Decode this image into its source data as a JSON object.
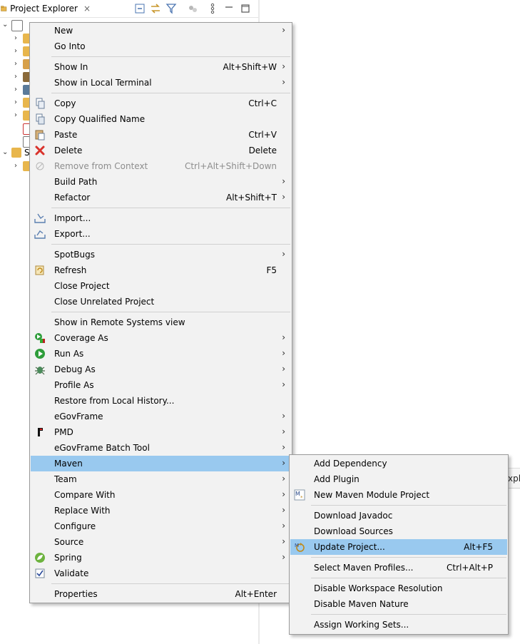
{
  "explorer": {
    "title": "Project Explorer",
    "close_glyph": "×",
    "toolbar": [
      "collapse-all-icon",
      "link-with-editor-icon",
      "filter-icon",
      "focus-icon",
      "view-menu-icon",
      "minimize-icon",
      "maximize-icon"
    ],
    "tree_partial_letter": "S"
  },
  "right_panel": {
    "partial_tab_text": "xplo"
  },
  "context_menu": {
    "items": [
      {
        "label": "New",
        "accel": "",
        "submenu": true,
        "icon": ""
      },
      {
        "label": "Go Into",
        "accel": "",
        "submenu": false,
        "icon": ""
      },
      {
        "label": "Show In",
        "accel": "Alt+Shift+W",
        "submenu": true,
        "icon": ""
      },
      {
        "label": "Show in Local Terminal",
        "accel": "",
        "submenu": true,
        "icon": ""
      },
      {
        "label": "Copy",
        "accel": "Ctrl+C",
        "submenu": false,
        "icon": "copy-icon"
      },
      {
        "label": "Copy Qualified Name",
        "accel": "",
        "submenu": false,
        "icon": "copy-qualified-name-icon"
      },
      {
        "label": "Paste",
        "accel": "Ctrl+V",
        "submenu": false,
        "icon": "paste-icon"
      },
      {
        "label": "Delete",
        "accel": "Delete",
        "submenu": false,
        "icon": "delete-icon"
      },
      {
        "label": "Remove from Context",
        "accel": "Ctrl+Alt+Shift+Down",
        "submenu": false,
        "icon": "remove-context-icon",
        "disabled": true
      },
      {
        "label": "Build Path",
        "accel": "",
        "submenu": true,
        "icon": ""
      },
      {
        "label": "Refactor",
        "accel": "Alt+Shift+T",
        "submenu": true,
        "icon": ""
      },
      {
        "label": "Import...",
        "accel": "",
        "submenu": false,
        "icon": "import-icon"
      },
      {
        "label": "Export...",
        "accel": "",
        "submenu": false,
        "icon": "export-icon"
      },
      {
        "label": "SpotBugs",
        "accel": "",
        "submenu": true,
        "icon": ""
      },
      {
        "label": "Refresh",
        "accel": "F5",
        "submenu": false,
        "icon": "refresh-icon"
      },
      {
        "label": "Close Project",
        "accel": "",
        "submenu": false,
        "icon": ""
      },
      {
        "label": "Close Unrelated Project",
        "accel": "",
        "submenu": false,
        "icon": ""
      },
      {
        "label": "Show in Remote Systems view",
        "accel": "",
        "submenu": false,
        "icon": ""
      },
      {
        "label": "Coverage As",
        "accel": "",
        "submenu": true,
        "icon": "coverage-icon"
      },
      {
        "label": "Run As",
        "accel": "",
        "submenu": true,
        "icon": "run-icon"
      },
      {
        "label": "Debug As",
        "accel": "",
        "submenu": true,
        "icon": "debug-icon"
      },
      {
        "label": "Profile As",
        "accel": "",
        "submenu": true,
        "icon": ""
      },
      {
        "label": "Restore from Local History...",
        "accel": "",
        "submenu": false,
        "icon": ""
      },
      {
        "label": "eGovFrame",
        "accel": "",
        "submenu": true,
        "icon": ""
      },
      {
        "label": "PMD",
        "accel": "",
        "submenu": true,
        "icon": "pmd-icon"
      },
      {
        "label": "eGovFrame Batch Tool",
        "accel": "",
        "submenu": true,
        "icon": ""
      },
      {
        "label": "Maven",
        "accel": "",
        "submenu": true,
        "icon": "",
        "highlighted": true
      },
      {
        "label": "Team",
        "accel": "",
        "submenu": true,
        "icon": ""
      },
      {
        "label": "Compare With",
        "accel": "",
        "submenu": true,
        "icon": ""
      },
      {
        "label": "Replace With",
        "accel": "",
        "submenu": true,
        "icon": ""
      },
      {
        "label": "Configure",
        "accel": "",
        "submenu": true,
        "icon": ""
      },
      {
        "label": "Source",
        "accel": "",
        "submenu": true,
        "icon": ""
      },
      {
        "label": "Spring",
        "accel": "",
        "submenu": true,
        "icon": "spring-icon"
      },
      {
        "label": "Validate",
        "accel": "",
        "submenu": false,
        "icon": "validate-check-icon"
      },
      {
        "label": "Properties",
        "accel": "Alt+Enter",
        "submenu": false,
        "icon": ""
      }
    ]
  },
  "maven_submenu": {
    "items": [
      {
        "label": "Add Dependency",
        "accel": "",
        "icon": ""
      },
      {
        "label": "Add Plugin",
        "accel": "",
        "icon": ""
      },
      {
        "label": "New Maven Module Project",
        "accel": "",
        "icon": "maven-module-icon"
      },
      {
        "label": "Download Javadoc",
        "accel": "",
        "icon": ""
      },
      {
        "label": "Download Sources",
        "accel": "",
        "icon": ""
      },
      {
        "label": "Update Project...",
        "accel": "Alt+F5",
        "icon": "maven-update-icon",
        "highlighted": true
      },
      {
        "label": "Select Maven Profiles...",
        "accel": "Ctrl+Alt+P",
        "icon": ""
      },
      {
        "label": "Disable Workspace Resolution",
        "accel": "",
        "icon": ""
      },
      {
        "label": "Disable Maven Nature",
        "accel": "",
        "icon": ""
      },
      {
        "label": "Assign Working Sets...",
        "accel": "",
        "icon": ""
      }
    ]
  },
  "glyphs": {
    "submenu_arrow": "›",
    "expand_arrow": "›",
    "expanded_arrow": "⌄"
  },
  "colors": {
    "highlight": "#99c9ef",
    "menu_bg": "#f2f2f2",
    "menu_border": "#9a9a9a",
    "separator": "#d0d0d0"
  }
}
